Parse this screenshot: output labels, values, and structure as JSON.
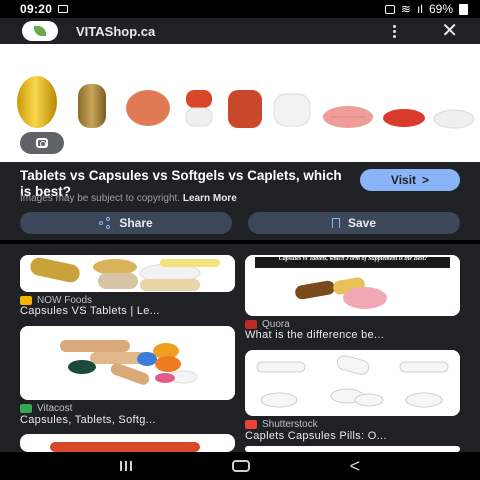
{
  "status_bar": {
    "time": "09:20",
    "battery": "69%"
  },
  "top_bar": {
    "site_name": "VITAShop.ca"
  },
  "result": {
    "title": "Tablets vs Capsules vs Softgels vs Caplets, which is best?",
    "visit_label": "Visit",
    "visit_arrow": ">",
    "copyright_text": "Images may be subject to copyright.",
    "learn_more": "Learn More",
    "share_label": "Share",
    "save_label": "Save"
  },
  "related": [
    {
      "source": "NOW Foods",
      "caption": "Capsules VS Tablets | Le...",
      "source_color": "#f4b400"
    },
    {
      "source": "Quora",
      "caption": "What is the difference be...",
      "source_color": "#b92b27",
      "overlay_text": "Capsules vs Tablets, which Form of Supplement is the Best?"
    },
    {
      "source": "Vitacost",
      "caption": "Capsules, Tablets, Softg...",
      "source_color": "#34a853"
    },
    {
      "source": "Shutterstock",
      "caption": "Caplets Capsules Pills: O...",
      "source_color": "#ea4335"
    }
  ],
  "colors": {
    "accent": "#8ab4f8",
    "background": "#202124",
    "button_bg": "#3c4759"
  }
}
